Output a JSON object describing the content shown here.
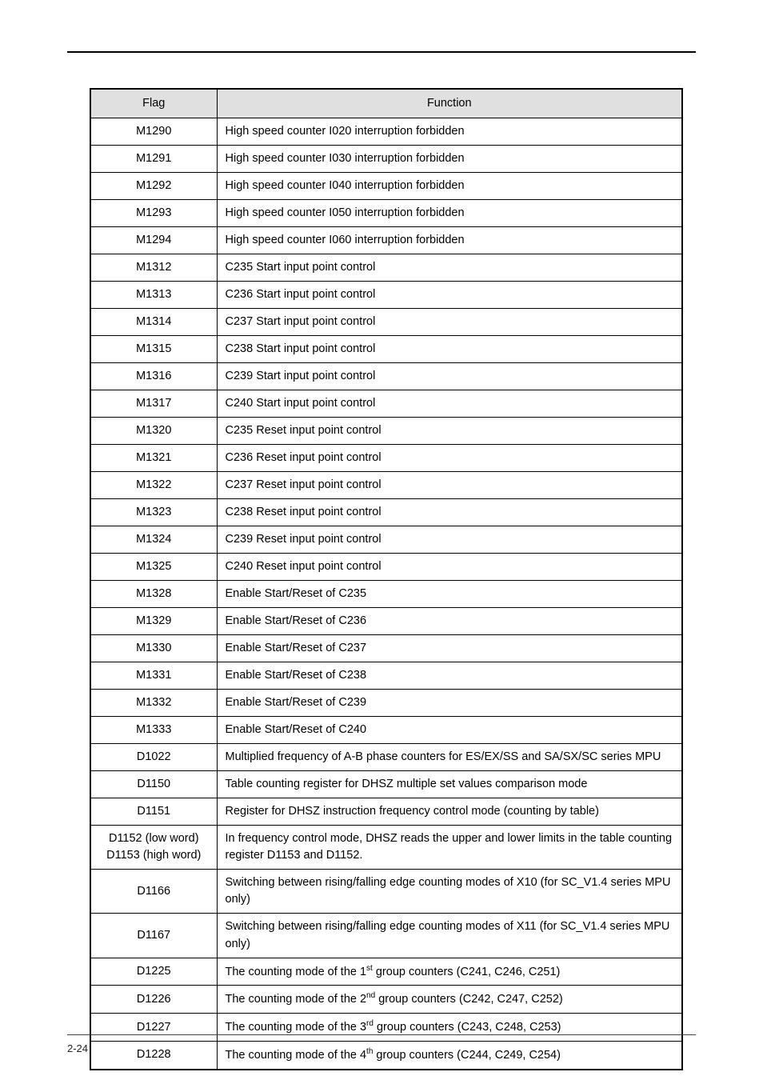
{
  "header": {
    "flag_label": "Flag",
    "function_label": "Function"
  },
  "rows": [
    {
      "flag": "M1290",
      "fn": "High speed counter I020 interruption forbidden"
    },
    {
      "flag": "M1291",
      "fn": "High speed counter I030 interruption forbidden"
    },
    {
      "flag": "M1292",
      "fn": "High speed counter I040 interruption forbidden"
    },
    {
      "flag": "M1293",
      "fn": "High speed counter I050 interruption forbidden"
    },
    {
      "flag": "M1294",
      "fn": "High speed counter I060 interruption forbidden"
    },
    {
      "flag": "M1312",
      "fn": "C235 Start input point control"
    },
    {
      "flag": "M1313",
      "fn": "C236 Start input point control"
    },
    {
      "flag": "M1314",
      "fn": "C237 Start input point control"
    },
    {
      "flag": "M1315",
      "fn": "C238 Start input point control"
    },
    {
      "flag": "M1316",
      "fn": "C239 Start input point control"
    },
    {
      "flag": "M1317",
      "fn": "C240 Start input point control"
    },
    {
      "flag": "M1320",
      "fn": "C235 Reset input point control"
    },
    {
      "flag": "M1321",
      "fn": "C236 Reset input point control"
    },
    {
      "flag": "M1322",
      "fn": "C237 Reset input point control"
    },
    {
      "flag": "M1323",
      "fn": "C238 Reset input point control"
    },
    {
      "flag": "M1324",
      "fn": "C239 Reset input point control"
    },
    {
      "flag": "M1325",
      "fn": "C240 Reset input point control"
    },
    {
      "flag": "M1328",
      "fn": "Enable Start/Reset of C235"
    },
    {
      "flag": "M1329",
      "fn": "Enable Start/Reset of C236"
    },
    {
      "flag": "M1330",
      "fn": "Enable Start/Reset of C237"
    },
    {
      "flag": "M1331",
      "fn": "Enable Start/Reset of C238"
    },
    {
      "flag": "M1332",
      "fn": "Enable Start/Reset of C239"
    },
    {
      "flag": "M1333",
      "fn": "Enable Start/Reset of C240"
    },
    {
      "flag": "D1022",
      "fn": "Multiplied frequency of A-B phase counters for ES/EX/SS and SA/SX/SC series MPU"
    },
    {
      "flag": "D1150",
      "fn": "Table counting register for DHSZ multiple set values comparison mode"
    },
    {
      "flag": "D1151",
      "fn": "Register for DHSZ instruction frequency control mode (counting by table)"
    },
    {
      "flag": "D1152 (low word)\nD1153 (high word)",
      "fn": "In frequency control mode, DHSZ reads the upper and lower limits in the table counting register D1153 and D1152."
    },
    {
      "flag": "D1166",
      "fn": "Switching between rising/falling edge counting modes of X10 (for SC_V1.4 series MPU only)"
    },
    {
      "flag": "D1167",
      "fn": "Switching between rising/falling edge counting modes of X11 (for SC_V1.4 series MPU only)"
    },
    {
      "flag": "D1225",
      "fn_pre": "The counting mode of the 1",
      "fn_sup": "st",
      "fn_post": " group counters (C241, C246, C251)"
    },
    {
      "flag": "D1226",
      "fn_pre": "The counting mode of the 2",
      "fn_sup": "nd",
      "fn_post": " group counters (C242, C247, C252)"
    },
    {
      "flag": "D1227",
      "fn_pre": "The counting mode of the 3",
      "fn_sup": "rd",
      "fn_post": " group counters (C243, C248, C253)"
    },
    {
      "flag": "D1228",
      "fn_pre": "The counting mode of the 4",
      "fn_sup": "th",
      "fn_post": " group counters (C244, C249, C254)"
    }
  ],
  "page_number": "2-24"
}
